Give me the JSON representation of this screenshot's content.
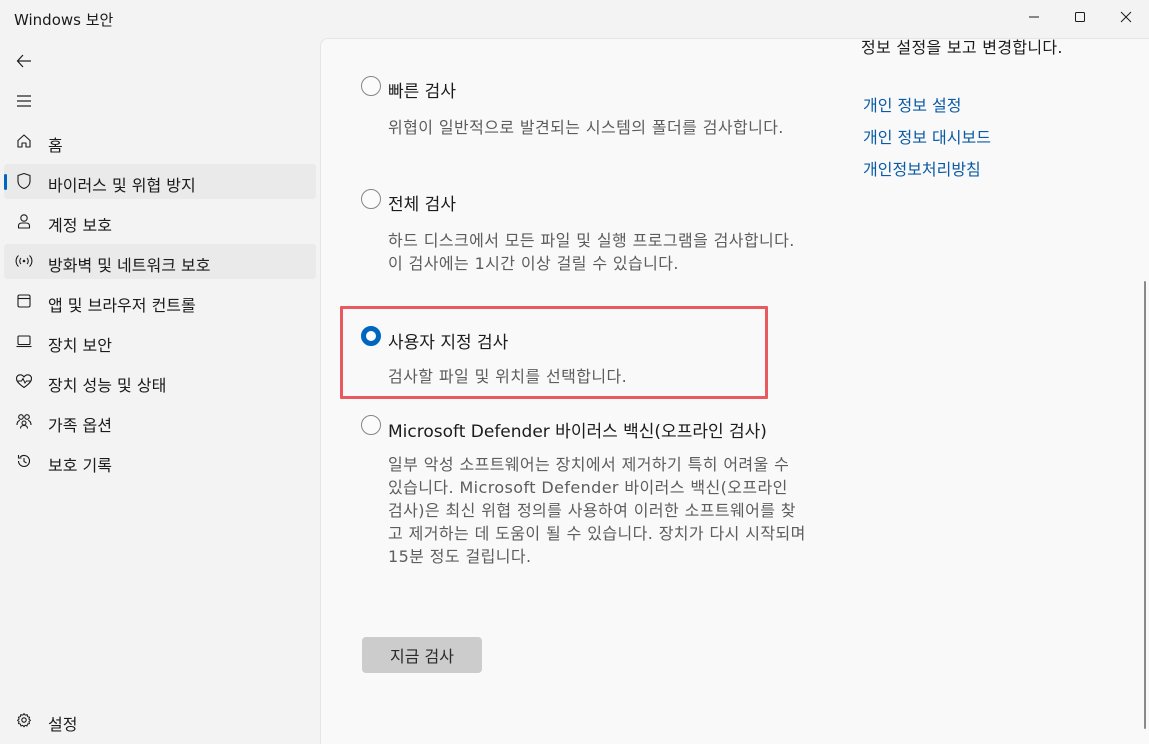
{
  "window": {
    "title": "Windows 보안"
  },
  "nav": {
    "items": [
      {
        "label": "홈",
        "icon": "home-icon"
      },
      {
        "label": "바이러스 및 위협 방지",
        "icon": "shield-icon"
      },
      {
        "label": "계정 보호",
        "icon": "person-icon"
      },
      {
        "label": "방화벽 및 네트워크 보호",
        "icon": "wireless-icon"
      },
      {
        "label": "앱 및 브라우저 컨트롤",
        "icon": "app-window-icon"
      },
      {
        "label": "장치 보안",
        "icon": "laptop-icon"
      },
      {
        "label": "장치 성능 및 상태",
        "icon": "heart-pulse-icon"
      },
      {
        "label": "가족 옵션",
        "icon": "family-icon"
      },
      {
        "label": "보호 기록",
        "icon": "history-icon"
      }
    ],
    "selected_index": 1,
    "settings_label": "설정"
  },
  "scan_options": [
    {
      "title": "빠른 검사",
      "description": "위협이 일반적으로 발견되는 시스템의 폴더를 검사합니다.",
      "checked": false
    },
    {
      "title": "전체 검사",
      "description": "하드 디스크에서 모든 파일 및 실행 프로그램을 검사합니다. 이 검사에는 1시간 이상 걸릴 수 있습니다.",
      "checked": false
    },
    {
      "title": "사용자 지정 검사",
      "description": "검사할 파일 및 위치를 선택합니다.",
      "checked": true
    },
    {
      "title": "Microsoft Defender 바이러스 백신(오프라인 검사)",
      "description": "일부 악성 소프트웨어는 장치에서 제거하기 특히 어려울 수 있습니다. Microsoft Defender 바이러스 백신(오프라인 검사)은 최신 위협 정의를 사용하여 이러한 소프트웨어를 찾고 제거하는 데 도움이 될 수 있습니다. 장치가 다시 시작되며 15분 정도 걸립니다.",
      "checked": false
    }
  ],
  "scan_button_label": "지금 검사",
  "privacy": {
    "text": "정보 설정을 보고 변경합니다.",
    "links": [
      "개인 정보 설정",
      "개인 정보 대시보드",
      "개인정보처리방침"
    ]
  },
  "colors": {
    "accent": "#0067c0",
    "highlight_border": "#e85a5f",
    "link": "#0a5aa5"
  }
}
